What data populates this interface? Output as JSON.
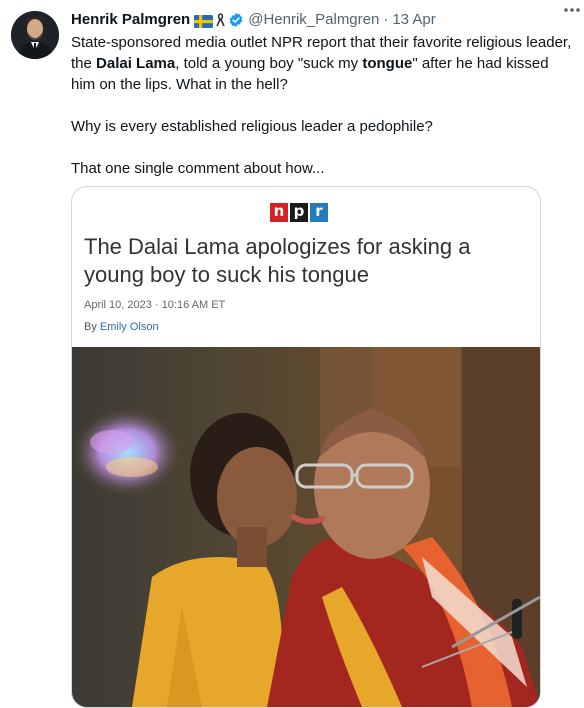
{
  "tweet": {
    "author_name": "Henrik Palmgren",
    "handle": "@Henrik_Palmgren",
    "separator": "·",
    "date": "13 Apr",
    "text": {
      "p1_a": "State-sponsored media outlet NPR report that their favorite religious leader, the ",
      "p1_bold1": "Dalai Lama",
      "p1_b": ", told a young boy \"suck my ",
      "p1_bold2": "tongue",
      "p1_c": "\" after he had kissed him on the lips. What in the hell?",
      "p2": "Why is every established religious leader a pedophile?",
      "p3": "That one single comment about how..."
    }
  },
  "card": {
    "logo": {
      "n": "n",
      "p": "p",
      "r": "r"
    },
    "headline": "The Dalai Lama apologizes for asking a young boy to suck his tongue",
    "date": "April 10, 2023 · 10:16 AM ET",
    "byline_prefix": "By ",
    "author": "Emily Olson"
  },
  "icons": {
    "flag": "sweden-flag-icon",
    "ribbon": "black-ribbon-icon",
    "verified": "verified-badge-icon",
    "more": "more-dots-icon"
  },
  "colors": {
    "verified_blue": "#1d9bf0",
    "npr_red": "#d62021",
    "npr_black": "#1a1a1a",
    "npr_blue": "#237bbd"
  }
}
